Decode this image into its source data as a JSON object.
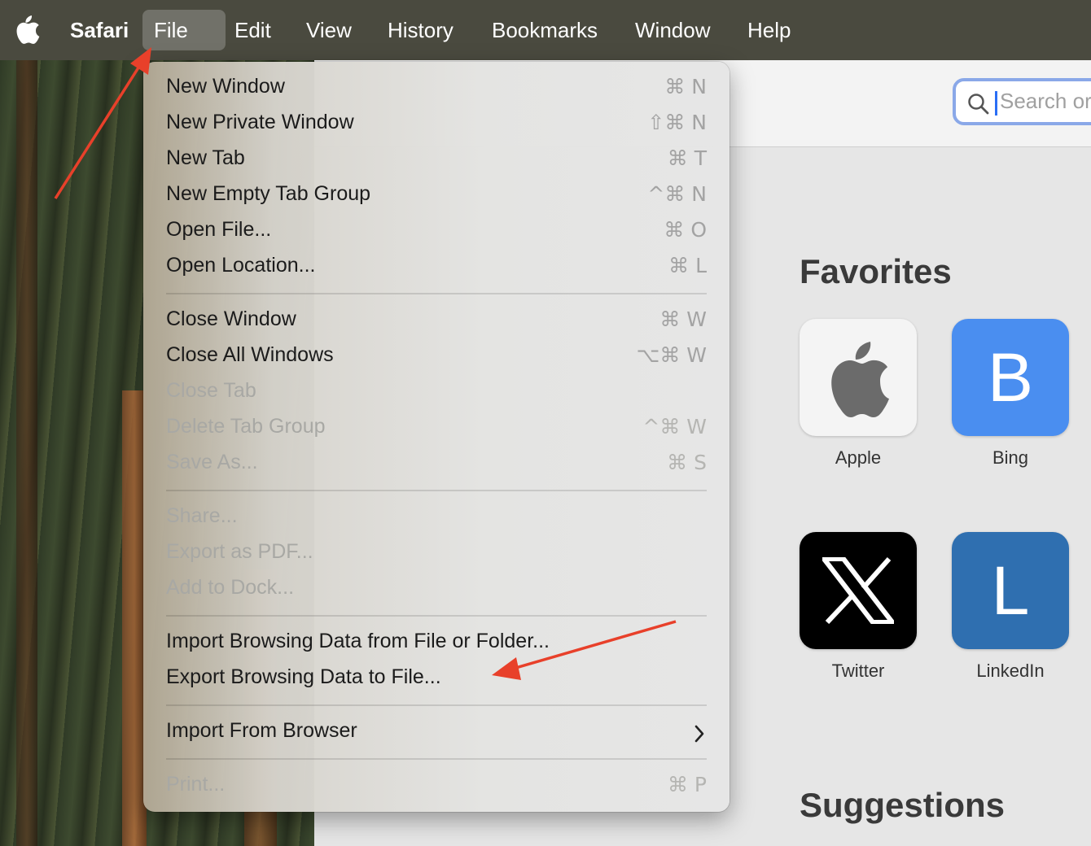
{
  "menubar": {
    "app_name": "Safari",
    "menus": [
      "File",
      "Edit",
      "View",
      "History",
      "Bookmarks",
      "Window",
      "Help"
    ],
    "active_menu": "File"
  },
  "safari": {
    "search": {
      "placeholder": "Search or"
    },
    "favorites_heading": "Favorites",
    "suggestions_heading": "Suggestions",
    "favorites": [
      {
        "label": "Apple",
        "tile": "",
        "bg": "#f2f2f2",
        "icon": "apple-logo-icon"
      },
      {
        "label": "Bing",
        "tile": "B",
        "bg": "#4a8ef0"
      },
      {
        "label": "Twitter",
        "tile": "",
        "bg": "#000000",
        "icon": "x-logo-icon"
      },
      {
        "label": "LinkedIn",
        "tile": "L",
        "bg": "#2f6fb0"
      }
    ]
  },
  "file_menu": {
    "items": [
      {
        "label": "New Window",
        "shortcut": "⌘ N",
        "enabled": true
      },
      {
        "label": "New Private Window",
        "shortcut": "⇧⌘ N",
        "enabled": true
      },
      {
        "label": "New Tab",
        "shortcut": "⌘ T",
        "enabled": true
      },
      {
        "label": "New Empty Tab Group",
        "shortcut": "^⌘ N",
        "enabled": true
      },
      {
        "label": "Open File...",
        "shortcut": "⌘ O",
        "enabled": true
      },
      {
        "label": "Open Location...",
        "shortcut": "⌘ L",
        "enabled": true
      },
      {
        "label": "Close Window",
        "shortcut": "⌘ W",
        "enabled": true
      },
      {
        "label": "Close All Windows",
        "shortcut": "⌥⌘ W",
        "enabled": true
      },
      {
        "label": "Close Tab",
        "shortcut": "",
        "enabled": false
      },
      {
        "label": "Delete Tab Group",
        "shortcut": "^⌘ W",
        "enabled": false
      },
      {
        "label": "Save As...",
        "shortcut": "⌘ S",
        "enabled": false
      },
      {
        "label": "Share...",
        "shortcut": "",
        "enabled": false
      },
      {
        "label": "Export as PDF...",
        "shortcut": "",
        "enabled": false
      },
      {
        "label": "Add to Dock...",
        "shortcut": "",
        "enabled": false
      },
      {
        "label": "Import Browsing Data from File or Folder...",
        "shortcut": "",
        "enabled": true
      },
      {
        "label": "Export Browsing Data to File...",
        "shortcut": "",
        "enabled": true
      },
      {
        "label": "Import From Browser",
        "shortcut": "",
        "enabled": true,
        "submenu": true
      },
      {
        "label": "Print...",
        "shortcut": "⌘ P",
        "enabled": false
      }
    ]
  },
  "annotation_color": "#e8402a"
}
